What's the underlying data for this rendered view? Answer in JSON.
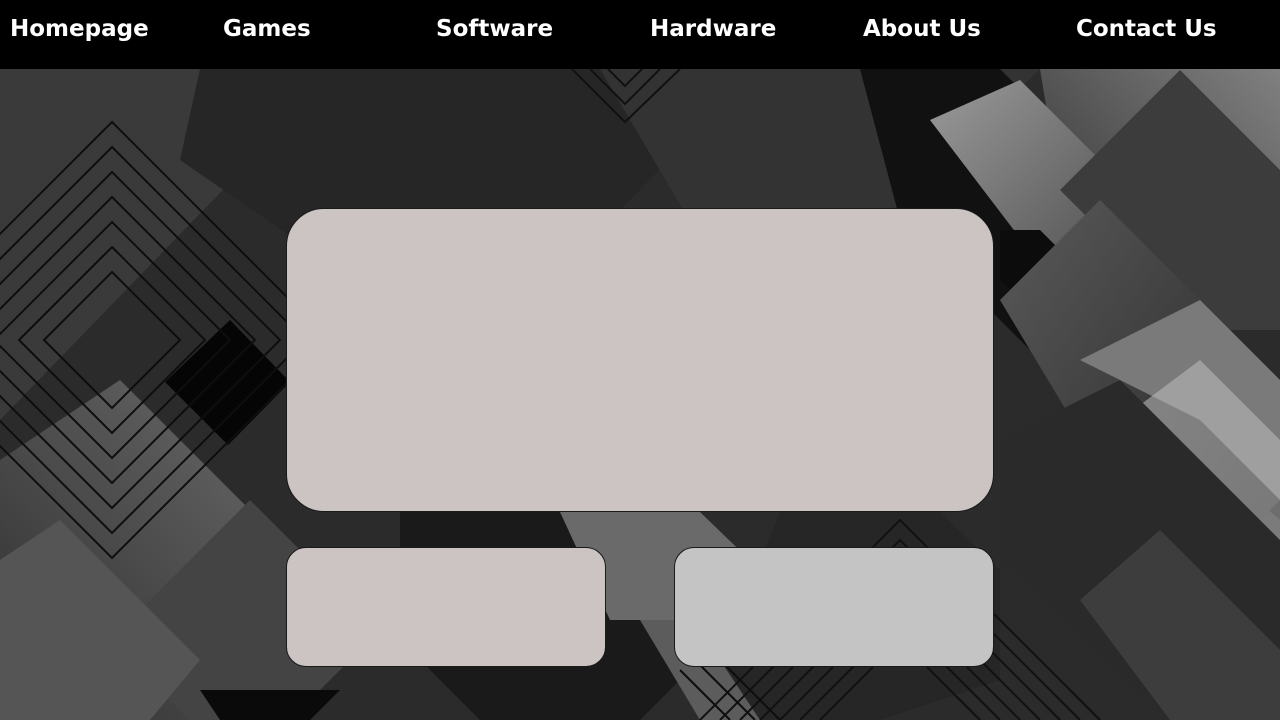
{
  "nav": {
    "items": [
      {
        "label": "Homepage"
      },
      {
        "label": "Games"
      },
      {
        "label": "Software"
      },
      {
        "label": "Hardware"
      },
      {
        "label": "About Us"
      },
      {
        "label": "Contact Us"
      }
    ]
  },
  "colors": {
    "navbar_bg": "#000000",
    "nav_text": "#ffffff",
    "panel_main": "#cbc4c2",
    "panel_left": "#cbc4c2",
    "panel_right": "#c4c4c4",
    "background_dark": "#1a1a1a"
  }
}
